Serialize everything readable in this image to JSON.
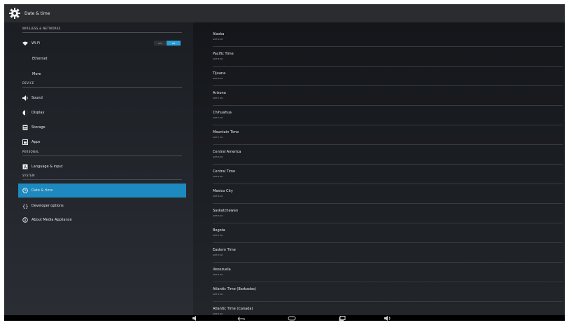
{
  "action_bar": {
    "title": "Date & time",
    "icon": "gear-icon"
  },
  "sidebar": {
    "sections": [
      {
        "header": "WIRELESS & NETWORKS"
      },
      {
        "header": "DEVICE"
      },
      {
        "header": "PERSONAL"
      },
      {
        "header": "SYSTEM"
      }
    ],
    "items": [
      {
        "label": "Wi-Fi",
        "icon": "wifi-icon"
      },
      {
        "label": "Ethernet"
      },
      {
        "label": "More"
      },
      {
        "label": "Sound",
        "icon": "speaker-icon"
      },
      {
        "label": "Display",
        "icon": "display-icon"
      },
      {
        "label": "Storage",
        "icon": "storage-icon"
      },
      {
        "label": "Apps",
        "icon": "apps-icon"
      },
      {
        "label": "Language & input",
        "icon": "language-icon"
      },
      {
        "label": "Date & time",
        "icon": "clock-icon",
        "selected": true
      },
      {
        "label": "Developer options",
        "icon": "braces-icon"
      },
      {
        "label": "About Media Appliance",
        "icon": "info-icon"
      }
    ],
    "wifi_toggle": {
      "off_label": "OFF",
      "on_label": "ON",
      "state": "on"
    }
  },
  "timezones": [
    {
      "name": "Alaska",
      "offset": "GMT-9:00"
    },
    {
      "name": "Pacific Time",
      "offset": "GMT-8:00"
    },
    {
      "name": "Tijuana",
      "offset": "GMT-8:00"
    },
    {
      "name": "Arizona",
      "offset": "GMT-7:00"
    },
    {
      "name": "Chihuahua",
      "offset": "GMT-7:00"
    },
    {
      "name": "Mountain Time",
      "offset": "GMT-7:00"
    },
    {
      "name": "Central America",
      "offset": "GMT-6:00"
    },
    {
      "name": "Central Time",
      "offset": "GMT-6:00"
    },
    {
      "name": "Mexico City",
      "offset": "GMT-6:00"
    },
    {
      "name": "Saskatchewan",
      "offset": "GMT-6:00"
    },
    {
      "name": "Bogota",
      "offset": "GMT-5:00"
    },
    {
      "name": "Eastern Time",
      "offset": "GMT-5:00"
    },
    {
      "name": "Venezuela",
      "offset": "GMT-4:30"
    },
    {
      "name": "Atlantic Time (Barbados)",
      "offset": "GMT-4:00"
    },
    {
      "name": "Atlantic Time (Canada)",
      "offset": "GMT-4:00"
    }
  ],
  "nav_bar": {
    "buttons": [
      "volume-down-icon",
      "back-icon",
      "home-icon",
      "recents-icon",
      "volume-up-icon"
    ]
  }
}
